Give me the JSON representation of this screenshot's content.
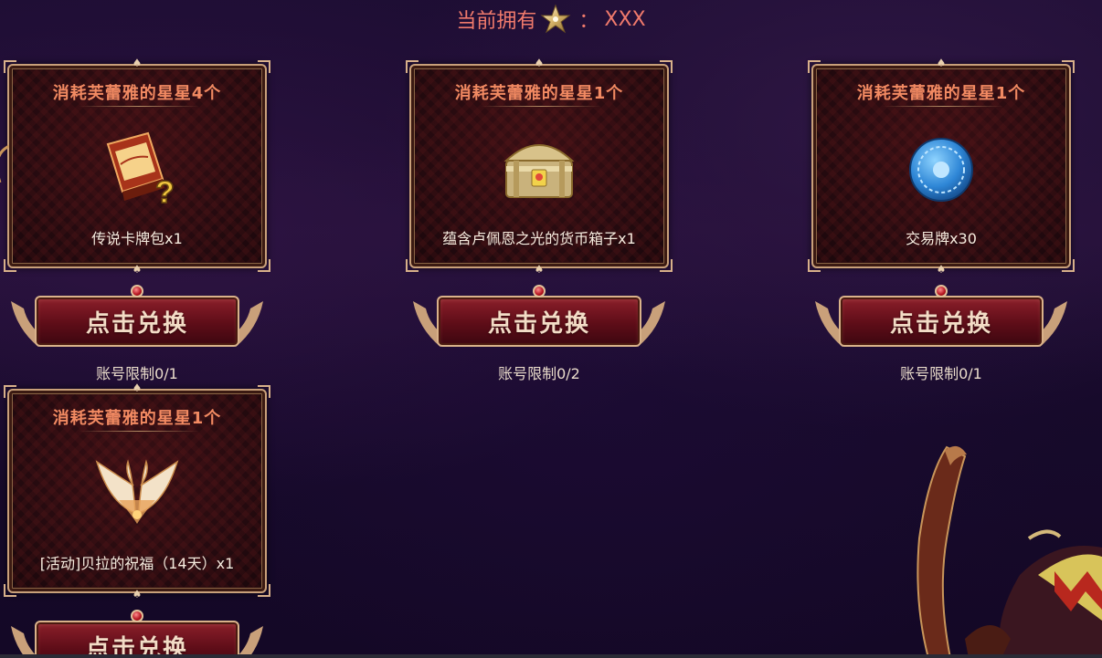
{
  "header": {
    "label": "当前拥有",
    "colon": "：",
    "value": "XXX",
    "currency_icon": "star-icon"
  },
  "colors": {
    "accent": "#f07a6c",
    "cost_text": "#f28a62",
    "frame_border": "#c9a07a",
    "button_red": "#8c1f2a",
    "background": "#170a2b"
  },
  "cards": [
    {
      "cost": "消耗芙蕾雅的星星4个",
      "item_name": "传说卡牌包x1",
      "item_icon": "card-pack-icon",
      "button_label": "点击兑换",
      "limit": "账号限制0/1"
    },
    {
      "cost": "消耗芙蕾雅的星星1个",
      "item_name": "蕴含卢佩恩之光的货币箱子x1",
      "item_icon": "treasure-chest-icon",
      "button_label": "点击兑换",
      "limit": "账号限制0/2"
    },
    {
      "cost": "消耗芙蕾雅的星星1个",
      "item_name": "交易牌x30",
      "item_icon": "trade-token-icon",
      "button_label": "点击兑换",
      "limit": "账号限制0/1"
    },
    {
      "cost": "消耗芙蕾雅的星星1个",
      "item_name": "[活动]贝拉的祝福（14天）x1",
      "item_icon": "wings-icon",
      "button_label": "点击兑换",
      "limit": ""
    }
  ]
}
